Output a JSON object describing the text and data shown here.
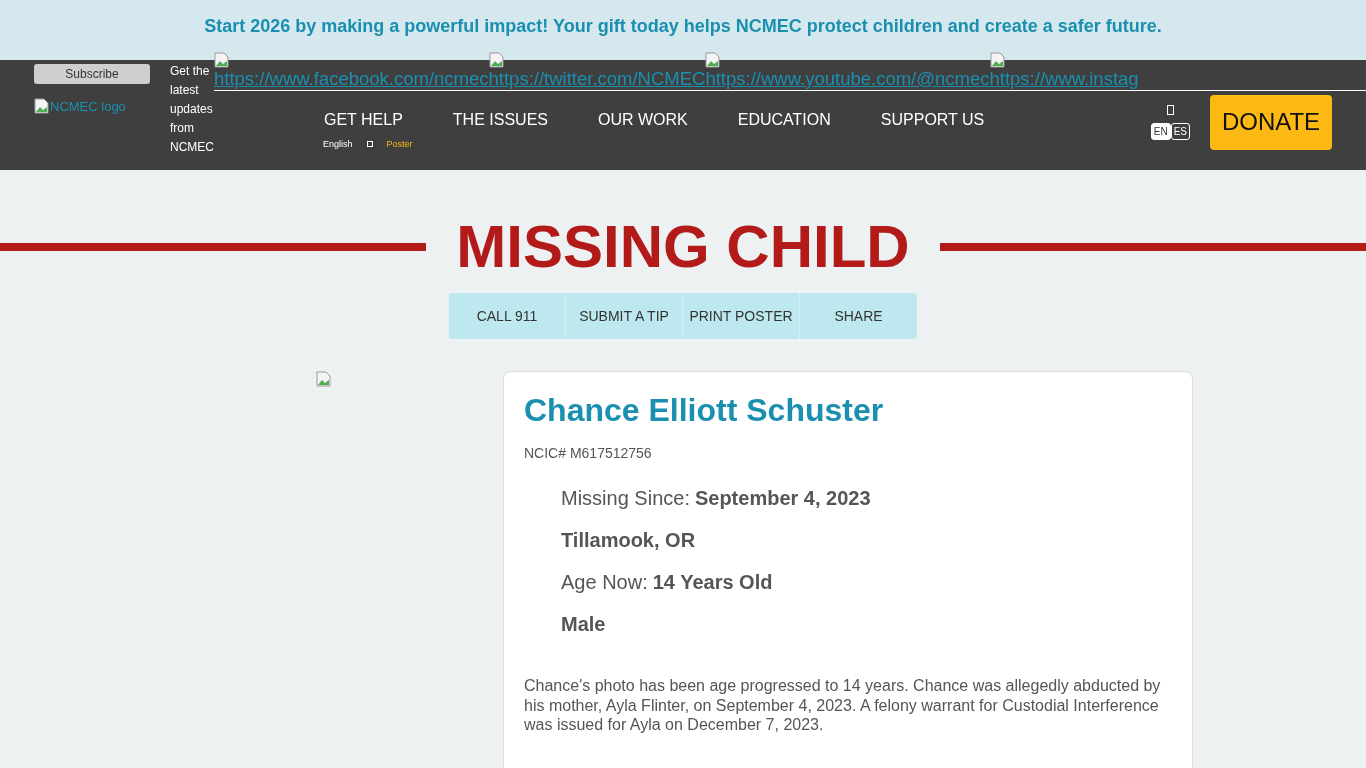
{
  "banner": {
    "text": "Start 2026 by making a powerful impact! Your gift today helps NCMEC protect children and create a safer future."
  },
  "header": {
    "subscribe": "Subscribe",
    "logo_alt": "NCMEC logo",
    "updates": "Get the latest updates from NCMEC",
    "social_links": [
      "https://www.facebook.com/ncmec",
      "https://twitter.com/NCMEC",
      "https://www.youtube.com/@ncmec",
      "https://www.instag"
    ],
    "nav": [
      "GET HELP",
      "THE ISSUES",
      "OUR WORK",
      "EDUCATION",
      "SUPPORT US"
    ],
    "sub_links": [
      {
        "label": "English",
        "kind": "plain"
      },
      {
        "label": "Poster",
        "kind": "highlight"
      }
    ],
    "languages": [
      {
        "label": "EN",
        "selected": true
      },
      {
        "label": "ES",
        "selected": false
      }
    ],
    "donate": "DONATE"
  },
  "title": "MISSING CHILD",
  "actions": [
    "CALL 911",
    "SUBMIT A TIP",
    "PRINT POSTER",
    "SHARE"
  ],
  "profile": {
    "name": "Chance Elliott Schuster",
    "ncic": "NCIC# M617512756",
    "facts": [
      {
        "label": "Missing Since:",
        "value": "September 4, 2023"
      },
      {
        "value": "Tillamook, OR"
      },
      {
        "label": "Age Now:",
        "value": "14 Years Old"
      },
      {
        "value": "Male"
      }
    ],
    "description": "Chance's photo has been age progressed to 14 years. Chance was allegedly abducted by his mother, Ayla Flinter, on September 4, 2023. A felony warrant for Custodial Interference was issued for Ayla on December 7, 2023."
  }
}
